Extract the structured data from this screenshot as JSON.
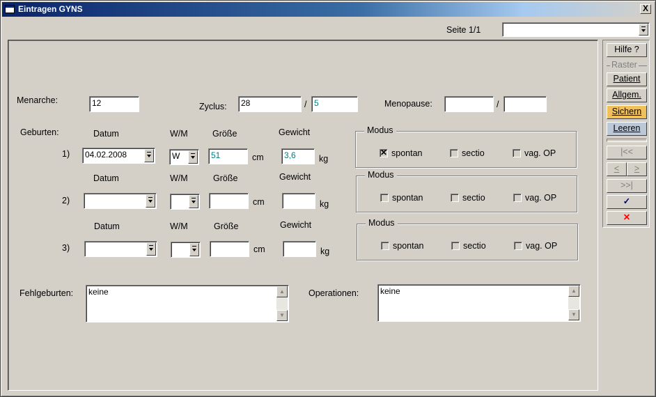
{
  "window": {
    "title": "Eintragen GYNS",
    "close": "X"
  },
  "header": {
    "seite": "Seite 1/1",
    "seite_select": ""
  },
  "menarche": {
    "label": "Menarche:",
    "value": "12"
  },
  "zyclus": {
    "label": "Zyclus:",
    "value1": "28",
    "sep": "/",
    "value2": "5"
  },
  "menopause": {
    "label": "Menopause:",
    "value1": "",
    "sep": "/",
    "value2": ""
  },
  "geburten": {
    "label": "Geburten:",
    "headers": {
      "datum": "Datum",
      "wm": "W/M",
      "groesse": "Größe",
      "gewicht": "Gewicht"
    },
    "unit_cm": "cm",
    "unit_kg": "kg",
    "rows": [
      {
        "num": "1)",
        "datum": "04.02.2008",
        "wm": "W",
        "groesse": "51",
        "gewicht": "3,6"
      },
      {
        "num": "2)",
        "datum": "",
        "wm": "",
        "groesse": "",
        "gewicht": ""
      },
      {
        "num": "3)",
        "datum": "",
        "wm": "",
        "groesse": "",
        "gewicht": ""
      }
    ]
  },
  "modus": {
    "title": "Modus",
    "options": [
      "spontan",
      "sectio",
      "vag. OP"
    ]
  },
  "fehlgeburten": {
    "label": "Fehlgeburten:",
    "value": "keine"
  },
  "operationen": {
    "label": "Operationen:",
    "value": "keine"
  },
  "sidebar": {
    "hilfe": "Hilfe ?",
    "raster": "Raster",
    "patient": "Patient",
    "allgem": "Allgem.",
    "sichern": "Sichern",
    "leeren": "Leeren",
    "first": "|<<",
    "prev": "<",
    "next": ">",
    "last": ">>|",
    "ok": "✓",
    "cancel": "✕",
    "ok_color": "#000080",
    "cancel_color": "#ff0000",
    "sichern_color": "#f0c05a"
  }
}
